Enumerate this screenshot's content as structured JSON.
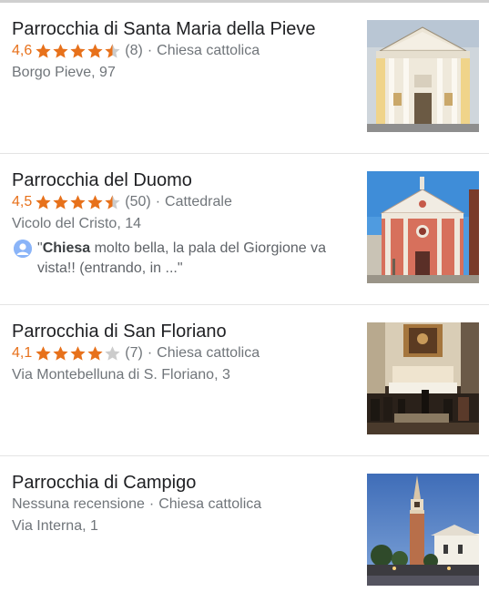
{
  "results": [
    {
      "title": "Parrocchia di Santa Maria della Pieve",
      "rating": "4,6",
      "rating_value": 4.6,
      "reviews": "(8)",
      "category": "Chiesa cattolica",
      "address": "Borgo Pieve, 97"
    },
    {
      "title": "Parrocchia del Duomo",
      "rating": "4,5",
      "rating_value": 4.5,
      "reviews": "(50)",
      "category": "Cattedrale",
      "address": "Vicolo del Cristo, 14",
      "review_open": "\"",
      "review_bold": "Chiesa",
      "review_rest": " molto bella, la pala del Giorgione va vista!! (entrando, in ...\""
    },
    {
      "title": "Parrocchia di San Floriano",
      "rating": "4,1",
      "rating_value": 4.1,
      "reviews": "(7)",
      "category": "Chiesa cattolica",
      "address": "Via Montebelluna di S. Floriano, 3"
    },
    {
      "title": "Parrocchia di Campigo",
      "no_reviews": "Nessuna recensione",
      "category": "Chiesa cattolica",
      "address": "Via Interna, 1"
    }
  ],
  "separator": "·",
  "colors": {
    "star": "#e7711b",
    "star_empty": "#cccccc",
    "meta": "#70757a",
    "title": "#202124"
  },
  "icons": {
    "star": "star-icon",
    "avatar": "user-avatar-icon"
  }
}
